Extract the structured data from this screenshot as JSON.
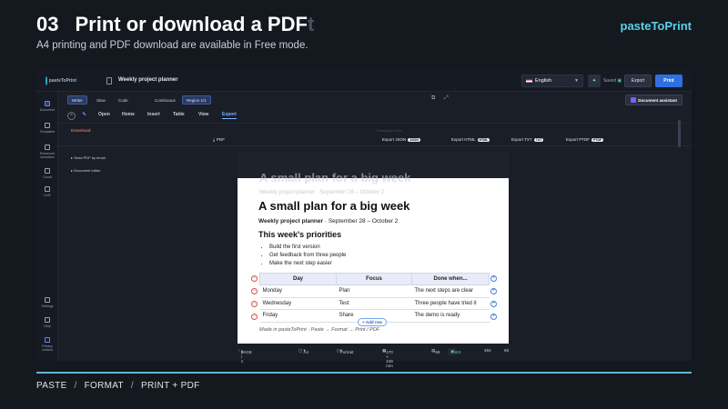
{
  "slide": {
    "number": "03",
    "title_main": "Print or download a PDF",
    "title_faded": "t",
    "subtitle": "A4 printing and PDF download are available in Free mode.",
    "brand": "pasteToPrint",
    "footer_steps": [
      "PASTE",
      "FORMAT",
      "PRINT + PDF"
    ],
    "footer_sep": "/"
  },
  "app": {
    "logo_text": "pasteToPrint",
    "doc_title": "Weekly project planner",
    "language": "English",
    "saved_label": "Saved",
    "export_label": "Export",
    "print_label": "Print",
    "sidebar": [
      {
        "label": "Document"
      },
      {
        "label": "Templates"
      },
      {
        "label": "Enhanced activation"
      },
      {
        "label": "Cloud"
      },
      {
        "label": "LIVE"
      },
      {
        "label": "Settings"
      },
      {
        "label": "Help"
      },
      {
        "label": "Privacy choices"
      }
    ],
    "modes": [
      "Writer",
      "Slow",
      "Code"
    ],
    "view_chips": [
      "Continuous",
      "Region 1/1"
    ],
    "doc_assistant": "Document assistant",
    "tabs": [
      "Open",
      "Home",
      "Insert",
      "Table",
      "View",
      "Export"
    ],
    "active_tab": "Export",
    "ribbon": {
      "download_label": "Download",
      "pdf_label": "PDF",
      "export_items": [
        {
          "label": "Export JSON",
          "badge": "JSON"
        },
        {
          "label": "Export HTML",
          "badge": "HTML"
        },
        {
          "label": "Export TXT",
          "badge": "TXT"
        },
        {
          "label": "Export PTDF",
          "badge": "PTDF"
        }
      ],
      "download_as_file": "Download a file"
    },
    "side_panel": {
      "send_pdf": "Send PDF by email",
      "document_editor": "Document editor"
    }
  },
  "preview": {
    "ghost_title": "A small plan for a big week",
    "ghost_sub": "Weekly project planner · September 28 – October 2",
    "title": "A small plan for a big week",
    "sub_bold": "Weekly project planner",
    "sub_rest": " · September 28 – October 2",
    "section": "This week's priorities",
    "bullets": [
      "Build the first version",
      "Get feedback from three people",
      "Make the next step easier"
    ],
    "table": {
      "headers": [
        "Day",
        "Focus",
        "Done when..."
      ],
      "rows": [
        [
          "Monday",
          "Plan",
          "The next steps are clear"
        ],
        [
          "Wednesday",
          "Test",
          "Three people have tried it"
        ],
        [
          "Friday",
          "Share",
          "The demo is ready"
        ]
      ]
    },
    "add_row": "Add row",
    "made_in": "Made in pasteToPrint · Paste → Format → Print / PDF"
  },
  "status": {
    "page_label": "PAGE",
    "page_value": "1 / 1",
    "paper": "A4",
    "orientation": "Portrait",
    "size": "170 × 249 mm",
    "count1": "68",
    "count2": "SIS",
    "count3": "364",
    "count4": "68"
  },
  "colors": {
    "accent": "#2f6fe0",
    "brand": "#5ad0e8",
    "footer_line": "#5fb8d6",
    "table_header": "#e8ecf8"
  }
}
